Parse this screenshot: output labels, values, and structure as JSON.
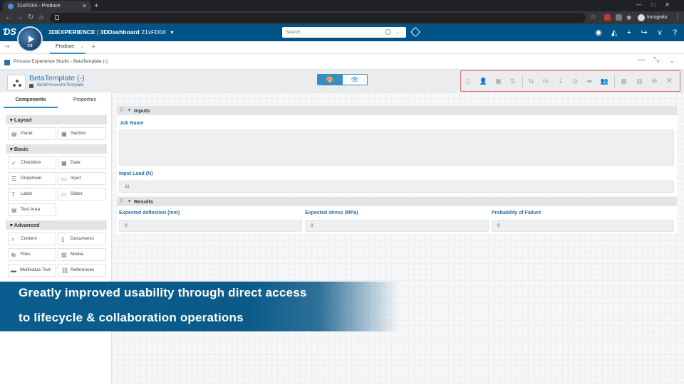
{
  "browser": {
    "tab_title": "21xFD04 - Produce",
    "incognito_label": "Incognito"
  },
  "topbar": {
    "brand_bold": "3DEXPERIENCE",
    "brand_sep": " | ",
    "brand_app": "3DDashboard",
    "dashboard_name": "21xFD04",
    "search_placeholder": "Search",
    "compass_version": "V.6"
  },
  "tabs": {
    "active_tab": "Produce"
  },
  "app": {
    "title": "Process Experience Studio - BetaTemplate (-)"
  },
  "template": {
    "title": "BetaTemplate (-)",
    "process_link": "BetaProcessforTemplate"
  },
  "left_panel": {
    "tabs": [
      "Components",
      "Properties"
    ],
    "sections": [
      {
        "name": "Layout",
        "items": [
          {
            "label": "Panel",
            "icon": "panel-icon"
          },
          {
            "label": "Section",
            "icon": "section-icon"
          }
        ]
      },
      {
        "name": "Basic",
        "items": [
          {
            "label": "Checkbox",
            "icon": "checkmark-icon"
          },
          {
            "label": "Date",
            "icon": "calendar-icon"
          },
          {
            "label": "Dropdown",
            "icon": "list-icon"
          },
          {
            "label": "Input",
            "icon": "input-icon"
          },
          {
            "label": "Label",
            "icon": "text-icon"
          },
          {
            "label": "Slider",
            "icon": "slider-icon"
          },
          {
            "label": "Text Area",
            "icon": "textarea-icon"
          }
        ]
      },
      {
        "name": "Advanced",
        "items": [
          {
            "label": "Content",
            "icon": "search-icon"
          },
          {
            "label": "Documents",
            "icon": "document-icon"
          },
          {
            "label": "Files",
            "icon": "files-icon"
          },
          {
            "label": "Media",
            "icon": "image-icon"
          },
          {
            "label": "Multivalue Text",
            "icon": "multivalue-icon"
          },
          {
            "label": "References",
            "icon": "link-icon"
          }
        ]
      }
    ]
  },
  "form": {
    "inputs_panel": {
      "title": "Inputs",
      "job_name_label": "Job Name",
      "job_name_value": "",
      "input_load_label": "Input Load (N)",
      "input_load_value": "11"
    },
    "results_panel": {
      "title": "Results",
      "fields": [
        {
          "label": "Expected deflection (mm)",
          "value": "0"
        },
        {
          "label": "Expected stress (MPa)",
          "value": "0"
        },
        {
          "label": "Probability of Failure",
          "value": "0"
        }
      ]
    }
  },
  "banner": {
    "line1": "Greatly improved usability through direct access",
    "line2": "to lifecycle & collaboration operations"
  },
  "colors": {
    "topbar": "#005386",
    "accent": "#368ec4",
    "highlight_border": "#e06666",
    "banner": "#0a5d8e"
  }
}
